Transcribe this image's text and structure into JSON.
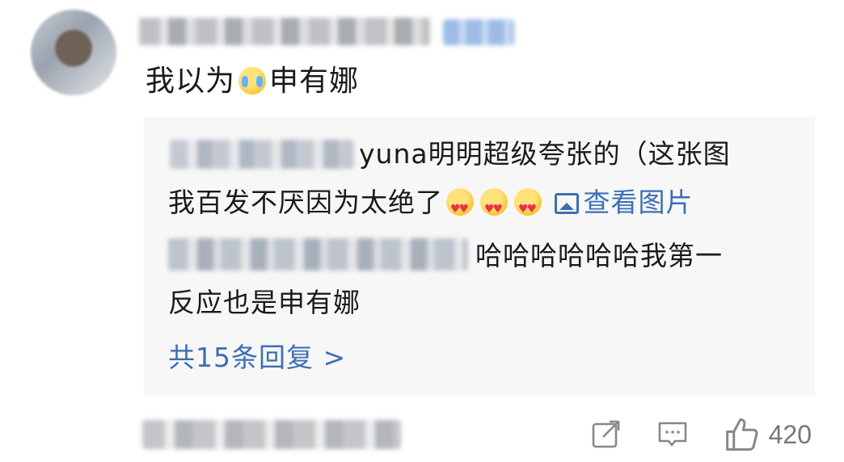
{
  "comment": {
    "text_before_emoji": "我以为",
    "text_after_emoji": "申有娜",
    "emoji": "laugh-cry-emoji"
  },
  "replies": [
    {
      "line1": "yuna明明超级夸张的（这张图",
      "line2": "我百发不厌因为太绝了",
      "view_image_label": "查看图片"
    },
    {
      "line1": "哈哈哈哈哈哈我第一",
      "line2": "反应也是申有娜"
    }
  ],
  "more_replies_label": "共15条回复 >",
  "actions": {
    "like_count": "420"
  },
  "colors": {
    "link": "#3c6fb4",
    "reply_bg": "#f7f7f7",
    "icon": "#888888"
  }
}
